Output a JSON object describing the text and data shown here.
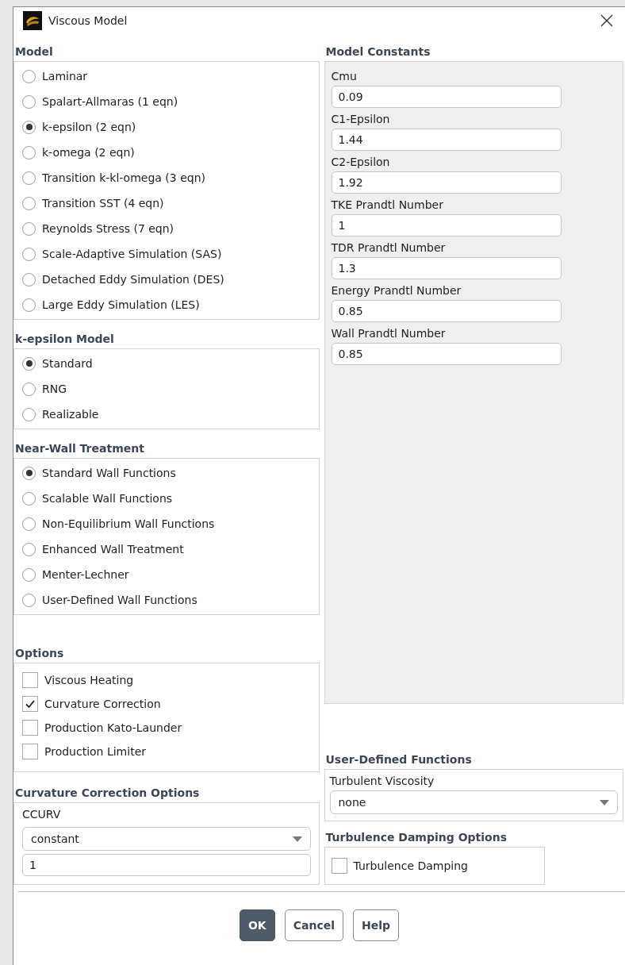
{
  "window": {
    "title": "Viscous Model"
  },
  "model": {
    "heading": "Model",
    "options": [
      {
        "label": "Laminar",
        "selected": false
      },
      {
        "label": "Spalart-Allmaras (1 eqn)",
        "selected": false
      },
      {
        "label": "k-epsilon (2 eqn)",
        "selected": true
      },
      {
        "label": "k-omega (2 eqn)",
        "selected": false
      },
      {
        "label": "Transition k-kl-omega (3 eqn)",
        "selected": false
      },
      {
        "label": "Transition SST (4 eqn)",
        "selected": false
      },
      {
        "label": "Reynolds Stress (7 eqn)",
        "selected": false
      },
      {
        "label": "Scale-Adaptive Simulation (SAS)",
        "selected": false
      },
      {
        "label": "Detached Eddy Simulation (DES)",
        "selected": false
      },
      {
        "label": "Large Eddy Simulation (LES)",
        "selected": false
      }
    ]
  },
  "k_epsilon_model": {
    "heading": "k-epsilon Model",
    "options": [
      {
        "label": "Standard",
        "selected": true
      },
      {
        "label": "RNG",
        "selected": false
      },
      {
        "label": "Realizable",
        "selected": false
      }
    ]
  },
  "near_wall_treatment": {
    "heading": "Near-Wall Treatment",
    "options": [
      {
        "label": "Standard Wall Functions",
        "selected": true
      },
      {
        "label": "Scalable Wall Functions",
        "selected": false
      },
      {
        "label": "Non-Equilibrium Wall Functions",
        "selected": false
      },
      {
        "label": "Enhanced Wall Treatment",
        "selected": false
      },
      {
        "label": "Menter-Lechner",
        "selected": false
      },
      {
        "label": "User-Defined Wall Functions",
        "selected": false
      }
    ]
  },
  "options": {
    "heading": "Options",
    "items": [
      {
        "label": "Viscous Heating",
        "checked": false
      },
      {
        "label": "Curvature Correction",
        "checked": true
      },
      {
        "label": "Production Kato-Launder",
        "checked": false
      },
      {
        "label": "Production Limiter",
        "checked": false
      }
    ]
  },
  "curvature_correction_options": {
    "heading": "Curvature Correction Options",
    "label": "CCURV",
    "method": "constant",
    "value": "1"
  },
  "model_constants": {
    "heading": "Model Constants",
    "fields": [
      {
        "label": "Cmu",
        "value": "0.09"
      },
      {
        "label": "C1-Epsilon",
        "value": "1.44"
      },
      {
        "label": "C2-Epsilon",
        "value": "1.92"
      },
      {
        "label": "TKE Prandtl Number",
        "value": "1"
      },
      {
        "label": "TDR Prandtl Number",
        "value": "1.3"
      },
      {
        "label": "Energy Prandtl Number",
        "value": "0.85"
      },
      {
        "label": "Wall Prandtl Number",
        "value": "0.85"
      }
    ]
  },
  "user_defined_functions": {
    "heading": "User-Defined Functions",
    "label": "Turbulent Viscosity",
    "value": "none"
  },
  "turbulence_damping_options": {
    "heading": "Turbulence Damping Options",
    "items": [
      {
        "label": "Turbulence Damping",
        "checked": false
      }
    ]
  },
  "buttons": [
    {
      "label": "OK",
      "kind": "primary"
    },
    {
      "label": "Cancel",
      "kind": "normal"
    },
    {
      "label": "Help",
      "kind": "normal"
    }
  ]
}
